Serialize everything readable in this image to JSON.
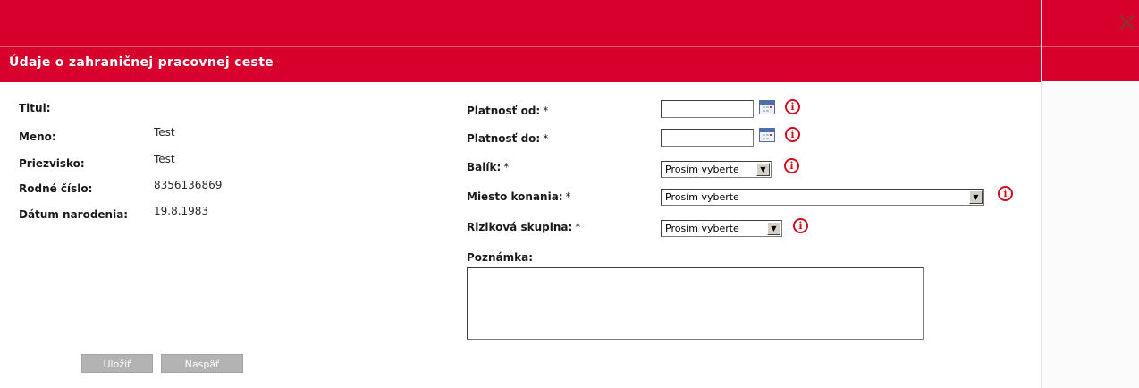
{
  "dialog": {
    "title": "Údaje o zahraničnej pracovnej ceste",
    "close_icon": "close-x-icon"
  },
  "person": {
    "titul_label": "Titul:",
    "titul_value": "",
    "meno_label": "Meno:",
    "meno_value": "Test",
    "priezvisko_label": "Priezvisko:",
    "priezvisko_value": "Test",
    "rodne_cislo_label": "Rodné číslo:",
    "rodne_cislo_value": "8356136869",
    "datum_label": "Dátum narodenia:",
    "datum_value": "19.8.1983"
  },
  "form": {
    "required_mark": "*",
    "platnost_od_label": "Platnosť od:",
    "platnost_od_value": "",
    "platnost_do_label": "Platnosť do:",
    "platnost_do_value": "",
    "balik_label": "Balík:",
    "balik_selected": "Prosím vyberte",
    "miesto_label": "Miesto konania:",
    "miesto_selected": "Prosím vyberte",
    "rizikova_label": "Riziková skupina:",
    "rizikova_selected": "Prosím vyberte",
    "poznamka_label": "Poznámka:",
    "poznamka_value": "",
    "info_glyph": "i"
  },
  "buttons": {
    "save_label": "Uložiť",
    "back_label": "Naspäť"
  },
  "colors": {
    "header_red": "#d7002c",
    "info_red": "#cc1020",
    "button_gray": "#b3b3b3"
  }
}
